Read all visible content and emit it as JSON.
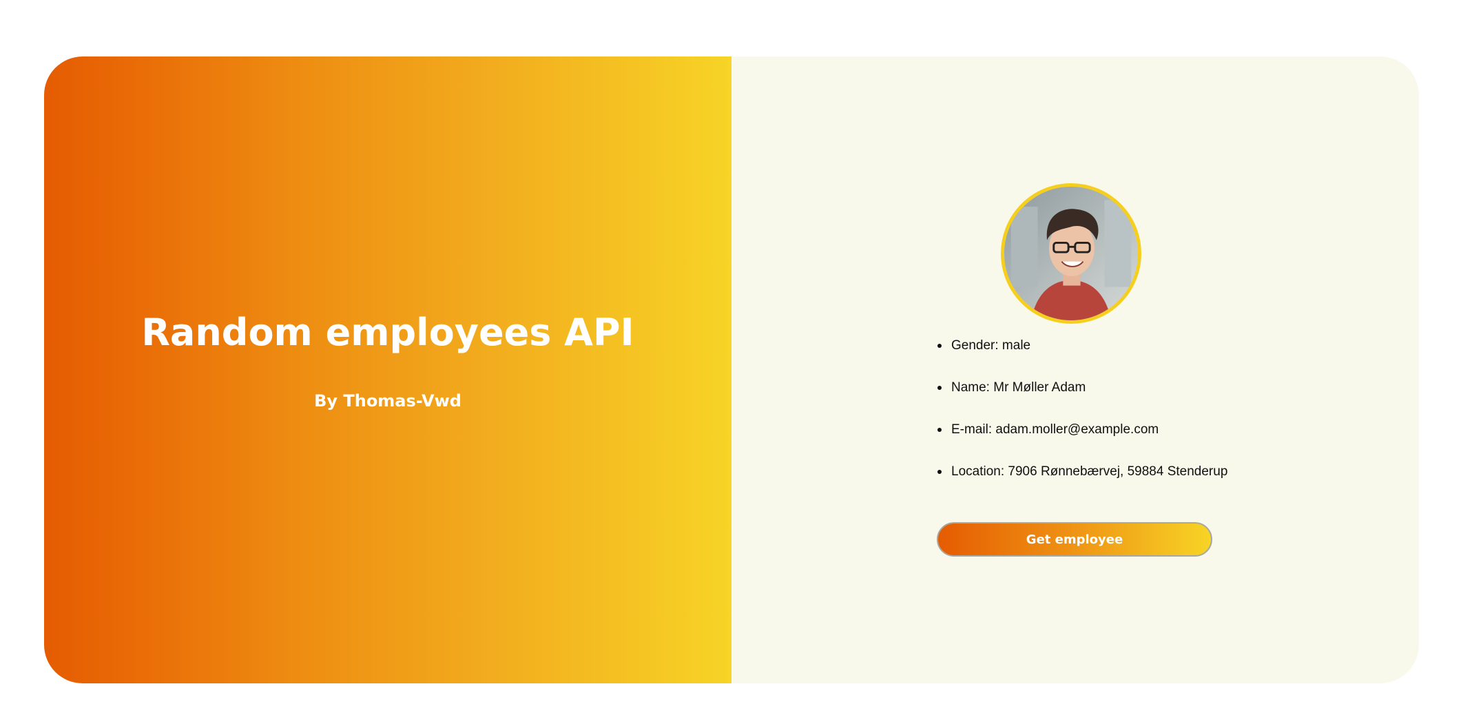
{
  "hero": {
    "title": "Random employees API",
    "author": "By Thomas-Vwd"
  },
  "employee": {
    "fields": [
      {
        "label": "Gender:",
        "value": "male"
      },
      {
        "label": "Name:",
        "value": "Mr Møller Adam"
      },
      {
        "label": "E-mail:",
        "value": "adam.moller@example.com"
      },
      {
        "label": "Location:",
        "value": "7906 Rønnebærvej, 59884 Stenderup"
      }
    ],
    "lines": [
      "Gender: male",
      "Name: Mr Møller Adam",
      "E-mail: adam.moller@example.com",
      "Location: 7906 Rønnebærvej, 59884 Stenderup"
    ]
  },
  "actions": {
    "get_employee_label": "Get employee"
  },
  "colors": {
    "gradient_start": "#e55c02",
    "gradient_end": "#f7d426",
    "avatar_border": "#f6cf1e",
    "right_panel_bg": "#f8f9ea",
    "page_bg": "#ffffff"
  },
  "icons": {
    "avatar": "employee-photo"
  }
}
